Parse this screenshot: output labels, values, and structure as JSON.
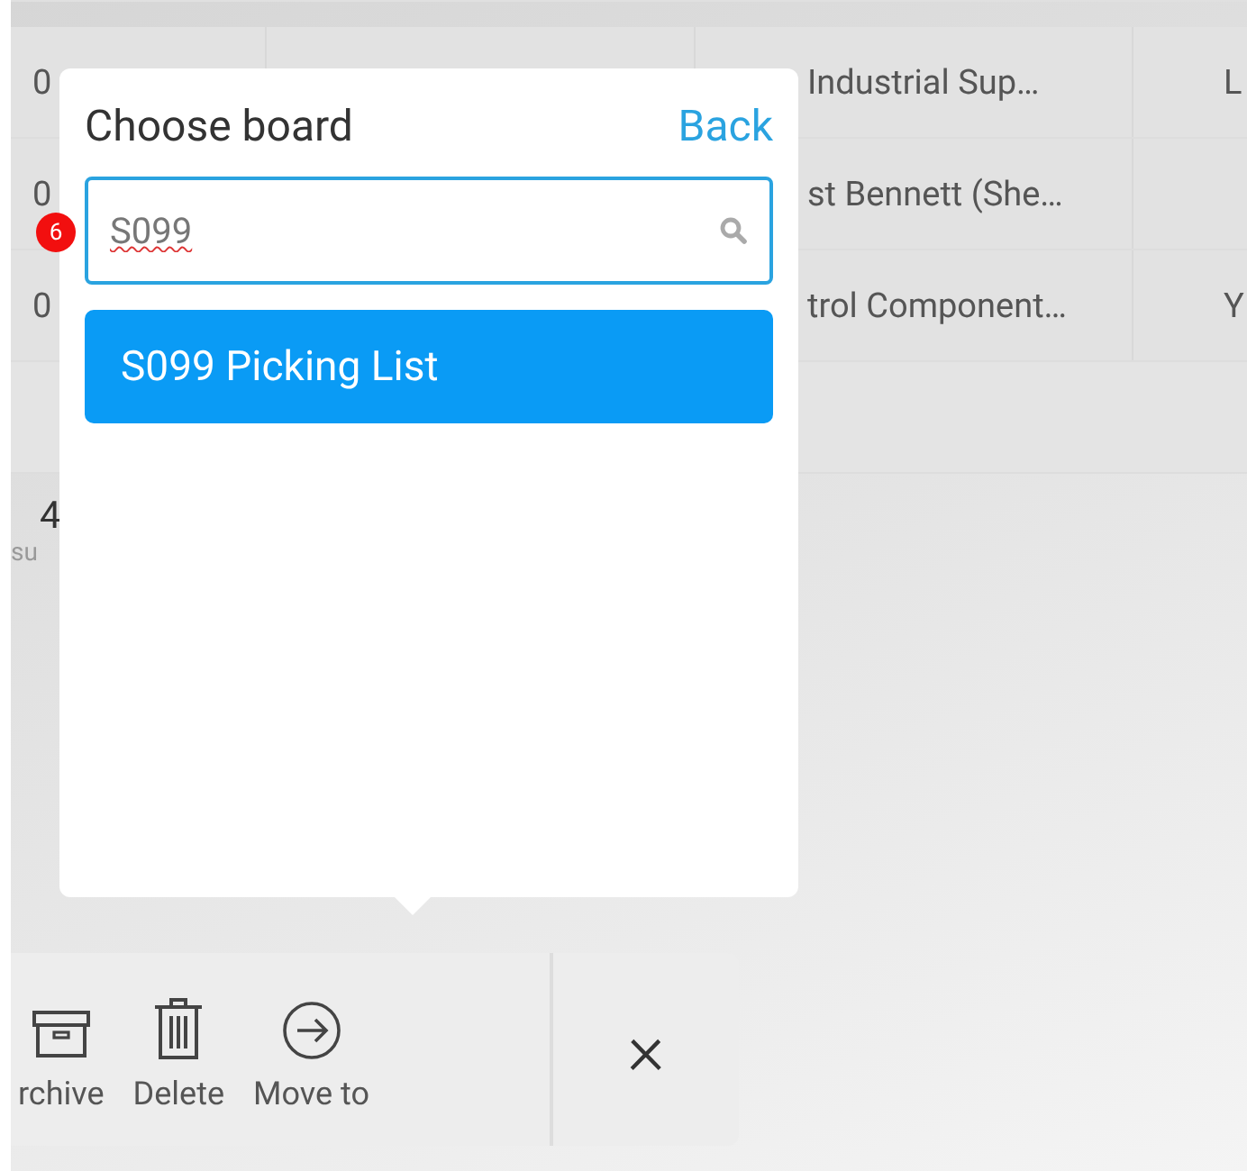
{
  "table": {
    "rows": [
      {
        "column_1": "0",
        "column_3": "Industrial Sup…",
        "column_4": "L"
      },
      {
        "column_1": "0",
        "column_3": "st Bennett (She…",
        "column_4": ""
      },
      {
        "column_1": "0",
        "column_3": "trol Component…",
        "column_4": "Y"
      }
    ],
    "summary": {
      "value": "4",
      "label": "su"
    }
  },
  "badge": {
    "count": "6"
  },
  "dialog": {
    "title": "Choose board",
    "back": "Back",
    "search": {
      "value": "S099"
    },
    "results": [
      {
        "label": "S099 Picking List",
        "selected": true
      }
    ]
  },
  "toolbar": {
    "actions": [
      {
        "kind": "archive",
        "label": "rchive"
      },
      {
        "kind": "delete",
        "label": "Delete"
      },
      {
        "kind": "move",
        "label": "Move to"
      }
    ],
    "close": "×"
  }
}
